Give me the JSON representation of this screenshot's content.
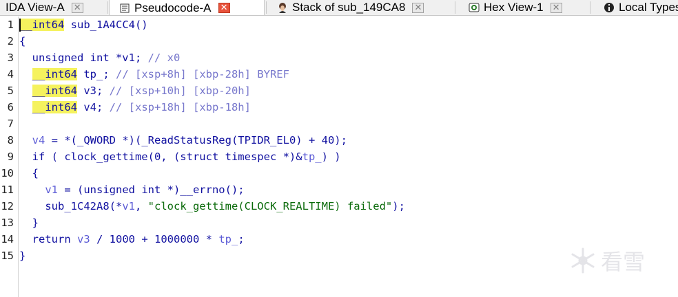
{
  "tabs": [
    {
      "label": "IDA View-A",
      "icon": "ida-view-icon",
      "active": false
    },
    {
      "label": "Pseudocode-A",
      "icon": "pseudocode-icon",
      "active": true
    },
    {
      "label": "Stack of sub_149CA8",
      "icon": "stack-icon",
      "active": false
    },
    {
      "label": "Hex View-1",
      "icon": "hex-icon",
      "active": false
    },
    {
      "label": "Local Types",
      "icon": "info-icon",
      "active": false
    }
  ],
  "close_glyph": "✕",
  "editor": {
    "lines": [
      {
        "n": "1",
        "parts": [
          {
            "t": "__int64",
            "c": "hl"
          },
          {
            "t": " sub_1A4CC4()",
            "c": "plain"
          }
        ]
      },
      {
        "n": "2",
        "parts": [
          {
            "t": "{",
            "c": "plain"
          }
        ]
      },
      {
        "n": "3",
        "parts": [
          {
            "t": "  unsigned int *v1; ",
            "c": "plain"
          },
          {
            "t": "// x0",
            "c": "cmt"
          }
        ]
      },
      {
        "n": "4",
        "parts": [
          {
            "t": "  ",
            "c": "plain"
          },
          {
            "t": "__int64",
            "c": "hl"
          },
          {
            "t": " tp_; ",
            "c": "plain"
          },
          {
            "t": "// [xsp+8h] [xbp-28h] BYREF",
            "c": "cmt"
          }
        ]
      },
      {
        "n": "5",
        "parts": [
          {
            "t": "  ",
            "c": "plain"
          },
          {
            "t": "__int64",
            "c": "hl"
          },
          {
            "t": " v3; ",
            "c": "plain"
          },
          {
            "t": "// [xsp+10h] [xbp-20h]",
            "c": "cmt"
          }
        ]
      },
      {
        "n": "6",
        "parts": [
          {
            "t": "  ",
            "c": "plain"
          },
          {
            "t": "__int64",
            "c": "hl"
          },
          {
            "t": " v4; ",
            "c": "plain"
          },
          {
            "t": "// [xsp+18h] [xbp-18h]",
            "c": "cmt"
          }
        ]
      },
      {
        "n": "7",
        "parts": [
          {
            "t": "",
            "c": "plain"
          }
        ]
      },
      {
        "n": "8",
        "parts": [
          {
            "t": "  ",
            "c": "plain"
          },
          {
            "t": "v4",
            "c": "var"
          },
          {
            "t": " = *(_QWORD *)(_ReadStatusReg(TPIDR_EL0) + 40);",
            "c": "plain"
          }
        ]
      },
      {
        "n": "9",
        "parts": [
          {
            "t": "  if ( clock_gettime(0, (struct timespec *)&",
            "c": "plain"
          },
          {
            "t": "tp_",
            "c": "var"
          },
          {
            "t": ") )",
            "c": "plain"
          }
        ]
      },
      {
        "n": "10",
        "parts": [
          {
            "t": "  {",
            "c": "plain"
          }
        ]
      },
      {
        "n": "11",
        "parts": [
          {
            "t": "    ",
            "c": "plain"
          },
          {
            "t": "v1",
            "c": "var"
          },
          {
            "t": " = (unsigned int *)__errno();",
            "c": "plain"
          }
        ]
      },
      {
        "n": "12",
        "parts": [
          {
            "t": "    sub_1C42A8(*",
            "c": "plain"
          },
          {
            "t": "v1",
            "c": "var"
          },
          {
            "t": ", ",
            "c": "plain"
          },
          {
            "t": "\"clock_gettime(CLOCK_REALTIME) failed\"",
            "c": "str"
          },
          {
            "t": ");",
            "c": "plain"
          }
        ]
      },
      {
        "n": "13",
        "parts": [
          {
            "t": "  }",
            "c": "plain"
          }
        ]
      },
      {
        "n": "14",
        "parts": [
          {
            "t": "  return ",
            "c": "plain"
          },
          {
            "t": "v3",
            "c": "var"
          },
          {
            "t": " / 1000 + 1000000 * ",
            "c": "plain"
          },
          {
            "t": "tp_",
            "c": "var"
          },
          {
            "t": ";",
            "c": "plain"
          }
        ]
      },
      {
        "n": "15",
        "parts": [
          {
            "t": "}",
            "c": "plain"
          }
        ]
      }
    ]
  },
  "watermark": {
    "text": "看雪",
    "icon": "snowflake-icon"
  },
  "colors": {
    "highlight": "#f5f25e",
    "code": "#1010a0",
    "comment": "#7777cc",
    "string": "#0a6a0a",
    "active_close": "#e8533c"
  }
}
